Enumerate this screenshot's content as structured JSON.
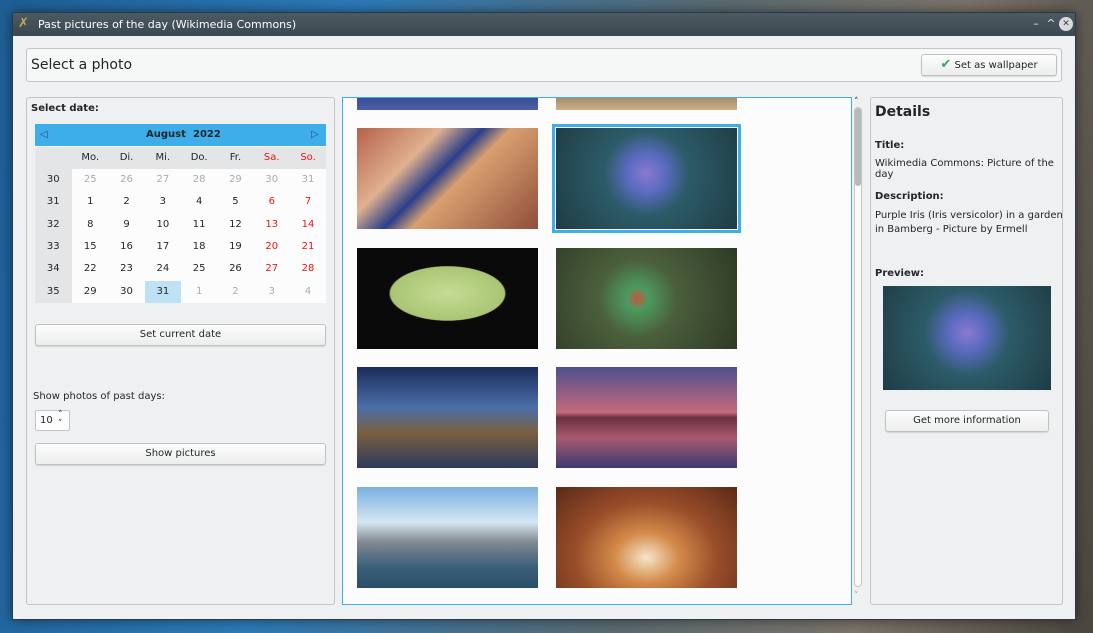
{
  "window": {
    "title": "Past pictures of the day (Wikimedia Commons)",
    "icon": "app-icon"
  },
  "header": {
    "title": "Select a photo",
    "wallpaper_button": "Set as wallpaper"
  },
  "left": {
    "select_date_label": "Select date:",
    "calendar": {
      "month": "August",
      "year": "2022",
      "weekdays": [
        "Mo.",
        "Di.",
        "Mi.",
        "Do.",
        "Fr.",
        "Sa.",
        "So."
      ],
      "weeks": [
        {
          "week": "30",
          "days": [
            "25",
            "26",
            "27",
            "28",
            "29",
            "30",
            "31"
          ],
          "other": [
            1,
            1,
            1,
            1,
            1,
            1,
            1
          ]
        },
        {
          "week": "31",
          "days": [
            "1",
            "2",
            "3",
            "4",
            "5",
            "6",
            "7"
          ],
          "other": [
            0,
            0,
            0,
            0,
            0,
            0,
            0
          ]
        },
        {
          "week": "32",
          "days": [
            "8",
            "9",
            "10",
            "11",
            "12",
            "13",
            "14"
          ],
          "other": [
            0,
            0,
            0,
            0,
            0,
            0,
            0
          ]
        },
        {
          "week": "33",
          "days": [
            "15",
            "16",
            "17",
            "18",
            "19",
            "20",
            "21"
          ],
          "other": [
            0,
            0,
            0,
            0,
            0,
            0,
            0
          ]
        },
        {
          "week": "34",
          "days": [
            "22",
            "23",
            "24",
            "25",
            "26",
            "27",
            "28"
          ],
          "other": [
            0,
            0,
            0,
            0,
            0,
            0,
            0
          ]
        },
        {
          "week": "35",
          "days": [
            "29",
            "30",
            "31",
            "1",
            "2",
            "3",
            "4"
          ],
          "other": [
            0,
            0,
            0,
            1,
            1,
            1,
            1
          ]
        }
      ],
      "selected": "31",
      "weekend_color": "#ed1515",
      "accent": "#3daee9"
    },
    "set_current_date": "Set current date",
    "past_days_label": "Show photos of past days:",
    "past_days_value": "10",
    "show_pictures": "Show pictures"
  },
  "photos": [
    {
      "name": "giant-clam",
      "g": "linear-gradient(135deg,#b5614a,#e0b08f 30%,#2c3f8a 45%,#d8a070 55%,#8f4e3a)"
    },
    {
      "name": "purple-iris",
      "g": "radial-gradient(circle at 50% 45%,#8a7ad0 0,#5b6bc0 18%,#2c5b68 40%,#1f3c44 100%)",
      "selected": true
    },
    {
      "name": "green-moth",
      "g": "radial-gradient(ellipse 45% 38% at 50% 45%,#c5dc94 0,#a9c574 70%,#0a0a0a 72%)"
    },
    {
      "name": "bee-eater-bird",
      "g": "radial-gradient(circle at 45% 50%,#c7553a 0,#4c9a5f 10%,#4b5f3c 35%,#2f3a25 100%)"
    },
    {
      "name": "night-ruins",
      "g": "linear-gradient(#1b2c5a,#4a6fa8 40%,#7a6040 65%,#2d3a5c)"
    },
    {
      "name": "lake-church",
      "g": "linear-gradient(#4e4f8f,#c66a7a 45%,#6b3040 50%,#a85a70 70%,#3b3a70)"
    },
    {
      "name": "manhattan-skyline",
      "g": "linear-gradient(#7ab0e0,#d5e6f2 35%,#808890 55%,#3a5f7a 80%,#2b4e68)"
    },
    {
      "name": "arched-corridor",
      "g": "radial-gradient(ellipse at 50% 70%,#f5e6c8 0,#d48a4a 25%,#9a4e2a 55%,#5a2a18 100%)"
    }
  ],
  "details": {
    "heading": "Details",
    "title_label": "Title:",
    "title": "Wikimedia Commons: Picture of the day",
    "description_label": "Description:",
    "description": "Purple Iris (Iris versicolor) in a garden in Bamberg - Picture by Ermell",
    "preview_label": "Preview:",
    "more_info": "Get more information"
  }
}
